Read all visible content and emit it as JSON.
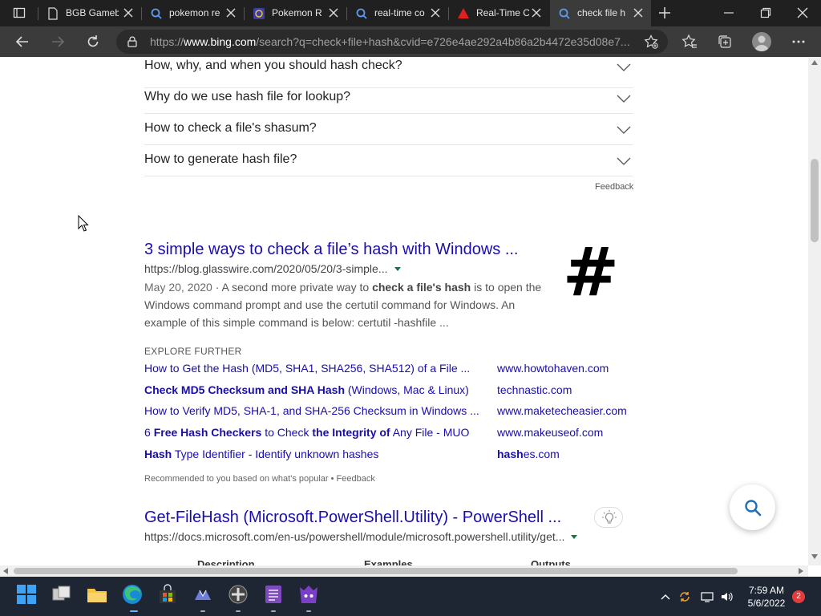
{
  "browser": {
    "tabs": [
      {
        "title": "BGB Gameb",
        "icon": "doc-icon",
        "active": false
      },
      {
        "title": "pokemon re",
        "icon": "bing-search-icon",
        "active": false
      },
      {
        "title": "Pokemon R",
        "icon": "pokemon-icon",
        "active": false
      },
      {
        "title": "real-time co",
        "icon": "bing-search-icon",
        "active": false
      },
      {
        "title": "Real-Time C",
        "icon": "warning-red-icon",
        "active": false
      },
      {
        "title": "check file h",
        "icon": "bing-search-icon",
        "active": true
      }
    ],
    "url": {
      "prefix": "https://",
      "host": "www.bing.com",
      "rest": "/search?q=check+file+hash&cvid=e726e4ae292a4b86a2b4472e35d08e7..."
    }
  },
  "faq": [
    "How, why, and when you should hash check?",
    "Why do we use hash file for lookup?",
    "How to check a file's shasum?",
    "How to generate hash file?"
  ],
  "feedback_label": "Feedback",
  "result1": {
    "title": "3 simple ways to check a file’s hash with Windows ...",
    "url": "https://blog.glasswire.com/2020/05/20/3-simple...",
    "date": "May 20, 2020",
    "snippet_parts": [
      "· A second more private way to ",
      "check a file's hash",
      " is to open the Windows command prompt and use the certutil command for Windows. An example of this simple command is below: certutil -hashfile ..."
    ],
    "thumb_text": "#"
  },
  "explore": {
    "heading": "EXPLORE FURTHER",
    "links": [
      {
        "parts": [
          [
            "How to Get the Hash (MD5, SHA1, SHA256, SHA512) of a File ...",
            false
          ]
        ],
        "site": [
          [
            "www.howtohaven.com",
            false
          ]
        ]
      },
      {
        "parts": [
          [
            "Check MD5 Checksum and SHA Hash",
            true
          ],
          [
            " (Windows, Mac & Linux)",
            false
          ]
        ],
        "site": [
          [
            "technastic.com",
            false
          ]
        ]
      },
      {
        "parts": [
          [
            "How to Verify MD5, SHA-1, and SHA-256 Checksum in Windows ...",
            false
          ]
        ],
        "site": [
          [
            "www.maketecheasier.com",
            false
          ]
        ]
      },
      {
        "parts": [
          [
            "6 ",
            false
          ],
          [
            "Free Hash Checkers",
            true
          ],
          [
            " to Check ",
            false
          ],
          [
            "the Integrity of",
            true
          ],
          [
            " Any File - MUO",
            false
          ]
        ],
        "site": [
          [
            "www.makeuseof.com",
            false
          ]
        ]
      },
      {
        "parts": [
          [
            "Hash",
            true
          ],
          [
            " Type Identifier - Identify unknown hashes",
            false
          ]
        ],
        "site": [
          [
            "hash",
            true
          ],
          [
            "es.com",
            false
          ]
        ]
      }
    ],
    "note": "Recommended to you based on what's popular • Feedback"
  },
  "result2": {
    "title": "Get-FileHash (Microsoft.PowerShell.Utility) - PowerShell ...",
    "url": "https://docs.microsoft.com/en-us/powershell/module/microsoft.powershell.utility/get...",
    "table_headers": [
      "Description",
      "Examples",
      "Outputs"
    ]
  },
  "taskbar": {
    "apps": [
      "windows-start-icon",
      "task-view-icon",
      "file-explorer-icon",
      "edge-icon",
      "store-icon",
      "app-icon-triangle",
      "gamepad-icon",
      "notes-app-icon",
      "game-app-icon"
    ],
    "time": "7:59 AM",
    "date": "5/6/2022",
    "notification_count": "2"
  },
  "colors": {
    "link": "#1a0dab",
    "tab_bg": "#202020",
    "toolbar_bg": "#3b3b3b",
    "taskbar_bg": "#1f2633"
  }
}
